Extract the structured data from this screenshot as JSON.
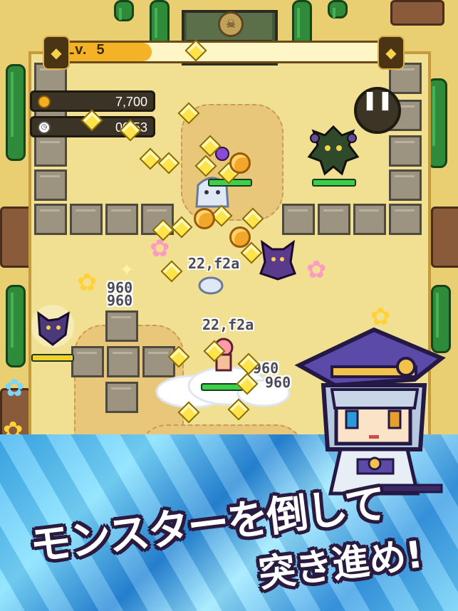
{
  "hud": {
    "level_label": "Lv.",
    "level_value": "5",
    "coins": "7,700",
    "timer": "00:53",
    "pause_icon": "pause-icon",
    "gate_icon": "skull-emblem-icon"
  },
  "damage_numbers": [
    "22,f2a",
    "960",
    "960",
    "22,f2a",
    "960",
    "960",
    "960"
  ],
  "banner": {
    "line1": "モンスターを倒して",
    "line2": "突き進め!"
  },
  "colors": {
    "sand": "#f1df92",
    "gem": "#ffe34a",
    "hp": "#3ad04a",
    "crystal": "#3fb2ee"
  }
}
